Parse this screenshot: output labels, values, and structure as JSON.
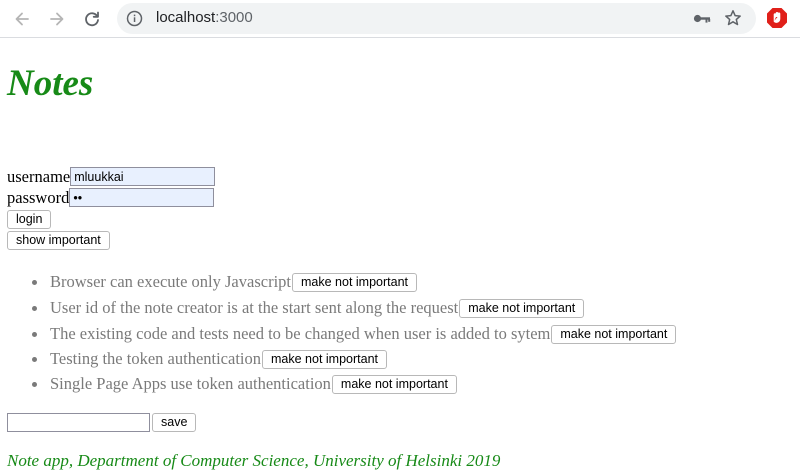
{
  "browser": {
    "url_host": "localhost",
    "url_port": ":3000"
  },
  "app": {
    "title": "Notes",
    "username_label": "username",
    "username_value": "mluukkai",
    "password_label": "password",
    "password_value": "ab",
    "login_label": "login",
    "show_important_label": "show important",
    "notes": [
      {
        "content": "Browser can execute only Javascript",
        "toggle_label": "make not important"
      },
      {
        "content": "User id of the note creator is at the start sent along the request",
        "toggle_label": "make not important"
      },
      {
        "content": "The existing code and tests need to be changed when user is added to sytem",
        "toggle_label": "make not important"
      },
      {
        "content": "Testing the token authentication",
        "toggle_label": "make not important"
      },
      {
        "content": "Single Page Apps use token authentication",
        "toggle_label": "make not important"
      }
    ],
    "new_note_value": "",
    "save_label": "save",
    "footer": "Note app, Department of Computer Science, University of Helsinki 2019"
  },
  "colors": {
    "title_green": "#178a17",
    "note_gray": "#7a7a7a",
    "autofill_bg": "#e8f0fe"
  }
}
